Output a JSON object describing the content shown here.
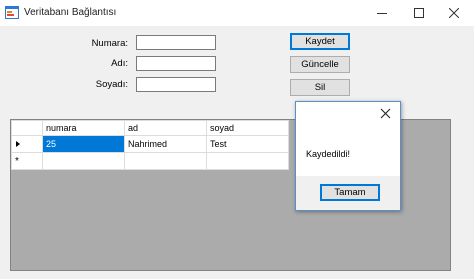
{
  "window": {
    "title": "Veritabanı Bağlantısı",
    "app_icon": "form-icon",
    "controls": [
      "minimize-icon",
      "maximize-icon",
      "close-icon"
    ]
  },
  "form": {
    "numara_label": "Numara:",
    "adi_label": "Adı:",
    "soyadi_label": "Soyadı:",
    "numara_value": "",
    "adi_value": "",
    "soyadi_value": ""
  },
  "buttons": {
    "kaydet": "Kaydet",
    "guncelle": "Güncelle",
    "sil": "Sil"
  },
  "grid": {
    "columns": [
      "numara",
      "ad",
      "soyad"
    ],
    "rows": [
      {
        "numara": "25",
        "ad": "Nahrimed",
        "soyad": "Test"
      }
    ],
    "new_row_marker": "*",
    "selection_color": "#0078d7"
  },
  "dialog": {
    "message": "Kaydedildi!",
    "ok_label": "Tamam"
  }
}
